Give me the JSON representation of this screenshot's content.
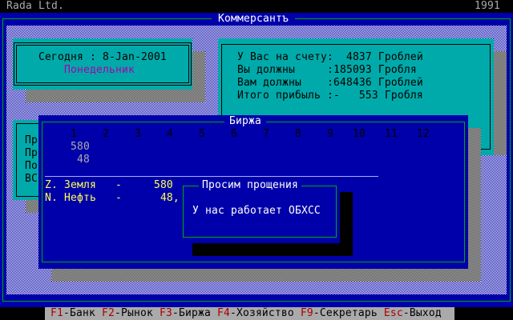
{
  "topbar": {
    "company": "Rada Ltd.",
    "year": "1991"
  },
  "main_window": {
    "title": "Коммерсантъ"
  },
  "date_panel": {
    "today_line": "Сегодня : 8-Jan-2001",
    "weekday": "Понедельник"
  },
  "account_panel": {
    "lines": [
      "У Вас на счету:  4837 Гроблей",
      "Вы должны     :185093 Гробля",
      "Вам должны    :648436 Гроблей",
      "Итого прибыль :-   553 Гробля"
    ]
  },
  "hidden_panel": {
    "labels": [
      "Пр",
      "Пр",
      "По",
      "ВС"
    ]
  },
  "exchange_window": {
    "title": "Биржа",
    "months": [
      "1",
      "2",
      "3",
      "4",
      "5",
      "6",
      "7",
      "8",
      "9",
      "10",
      "11",
      "12"
    ],
    "values_row1": "580",
    "values_row2": "48",
    "items": [
      "Z. Земля   -     580 з",
      "N. Нефть   -      48,"
    ]
  },
  "dialog": {
    "title": "Просим прощения",
    "message": "У нас работает ОБХСС"
  },
  "menu": [
    {
      "key": "F1",
      "label": "-Банк"
    },
    {
      "key": "F2",
      "label": "-Рынок"
    },
    {
      "key": "F3",
      "label": "-Биржа"
    },
    {
      "key": "F4",
      "label": "-Хозяйство"
    },
    {
      "key": "F9",
      "label": "-Секретарь"
    },
    {
      "key": "Esc",
      "label": "-Выход"
    }
  ]
}
